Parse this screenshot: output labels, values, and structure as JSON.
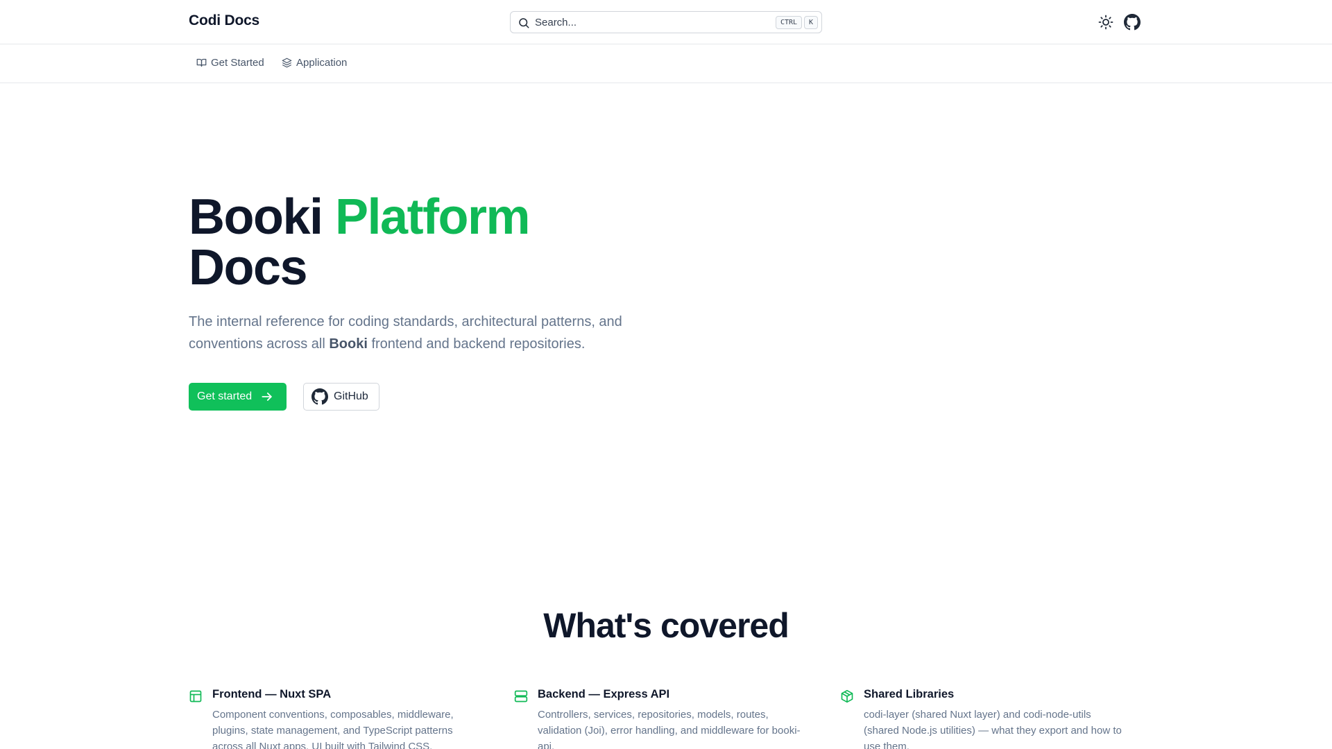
{
  "header": {
    "brand": "Codi Docs",
    "search_placeholder": "Search...",
    "shortcut_ctrl": "CTRL",
    "shortcut_key": "K",
    "theme_icon": "sun-icon",
    "github_icon": "github-icon"
  },
  "subnav": {
    "items": [
      {
        "label": "Get Started",
        "icon": "book-open-icon"
      },
      {
        "label": "Application",
        "icon": "layers-icon"
      }
    ]
  },
  "hero": {
    "title_part1": "Booki ",
    "title_accent": "Platform",
    "title_part2": "Docs",
    "desc_before": "The internal reference for coding standards, architectural patterns, and conventions across all ",
    "desc_bold": "Booki",
    "desc_after": " frontend and backend repositories.",
    "primary_button": "Get started",
    "secondary_button": "GitHub"
  },
  "covered": {
    "title": "What's covered",
    "features": [
      {
        "title": "Frontend — Nuxt SPA",
        "description": "Component conventions, composables, middleware, plugins, state management, and TypeScript patterns across all Nuxt apps. UI built with Tailwind CSS.",
        "icon": "layout-icon"
      },
      {
        "title": "Backend — Express API",
        "description": "Controllers, services, repositories, models, routes, validation (Joi), error handling, and middleware for booki-api.",
        "icon": "server-icon"
      },
      {
        "title": "Shared Libraries",
        "description": "codi-layer (shared Nuxt layer) and codi-node-utils (shared Node.js utilities) — what they export and how to use them.",
        "icon": "package-icon"
      }
    ]
  },
  "colors": {
    "accent": "#10b956",
    "button": "#10c05a",
    "text": "#0f172a",
    "muted": "#64748b"
  }
}
